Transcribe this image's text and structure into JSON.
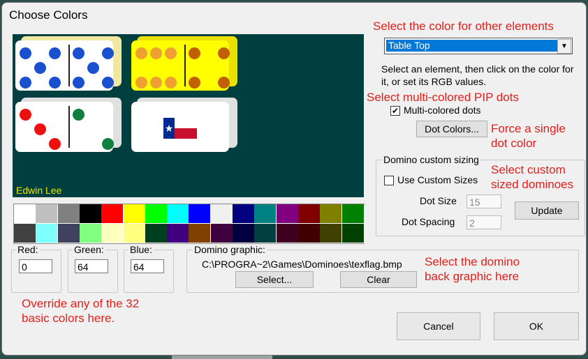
{
  "dialog": {
    "title": "Choose Colors"
  },
  "preview": {
    "author": "Edwin Lee"
  },
  "colors": {
    "dots_blue": "#1a4fcf",
    "dots_orange": "#f0a030",
    "dots_brown": "#c06000",
    "dots_red": "#ee1010",
    "dots_green": "#10803c",
    "table_top": "#003f3f"
  },
  "palette": [
    "#ffffff",
    "#c0c0c0",
    "#808080",
    "#000000",
    "#ff0000",
    "#ffff00",
    "#00ff00",
    "#00ffff",
    "#0000ff",
    "#f0f0f0",
    "#000080",
    "#008080",
    "#800080",
    "#800000",
    "#808000",
    "#008000",
    "#404040",
    "#80ffff",
    "#404060",
    "#80ff80",
    "#ffffc0",
    "#ffff80",
    "#004020",
    "#400080",
    "#804000",
    "#400040",
    "#000040",
    "#004040",
    "#400020",
    "#400000",
    "#404000",
    "#004000"
  ],
  "element_select": {
    "value": "Table Top"
  },
  "instructions": "Select an element, then click on the color for it, or set its RGB values.",
  "multicolor": {
    "checked": "✔",
    "label": "Multi-colored dots"
  },
  "buttons": {
    "dot_colors": "Dot Colors...",
    "update": "Update",
    "select_graphic": "Select...",
    "clear": "Clear",
    "cancel": "Cancel",
    "ok": "OK"
  },
  "custom_sizing": {
    "caption": "Domino custom sizing",
    "use_custom_label": "Use Custom Sizes",
    "dot_size_label": "Dot Size",
    "dot_size_value": "15",
    "dot_spacing_label": "Dot Spacing",
    "dot_spacing_value": "2"
  },
  "rgb": {
    "red_label": "Red:",
    "red_value": "0",
    "green_label": "Green:",
    "green_value": "64",
    "blue_label": "Blue:",
    "blue_value": "64"
  },
  "graphic": {
    "caption": "Domino graphic:",
    "path": "C:\\PROGRA~2\\Games\\Dominoes\\texflag.bmp"
  },
  "annotations": {
    "other_elements": "Select the color for other elements",
    "pip_dots": "Select multi-colored PIP dots",
    "single_color_1": "Force a single",
    "single_color_2": "dot color",
    "custom_sized_1": "Select custom",
    "custom_sized_2": "sized dominoes",
    "back_graphic_1": "Select the domino",
    "back_graphic_2": "back graphic here",
    "override_1": "Override any of the 32",
    "override_2": "basic colors here."
  }
}
